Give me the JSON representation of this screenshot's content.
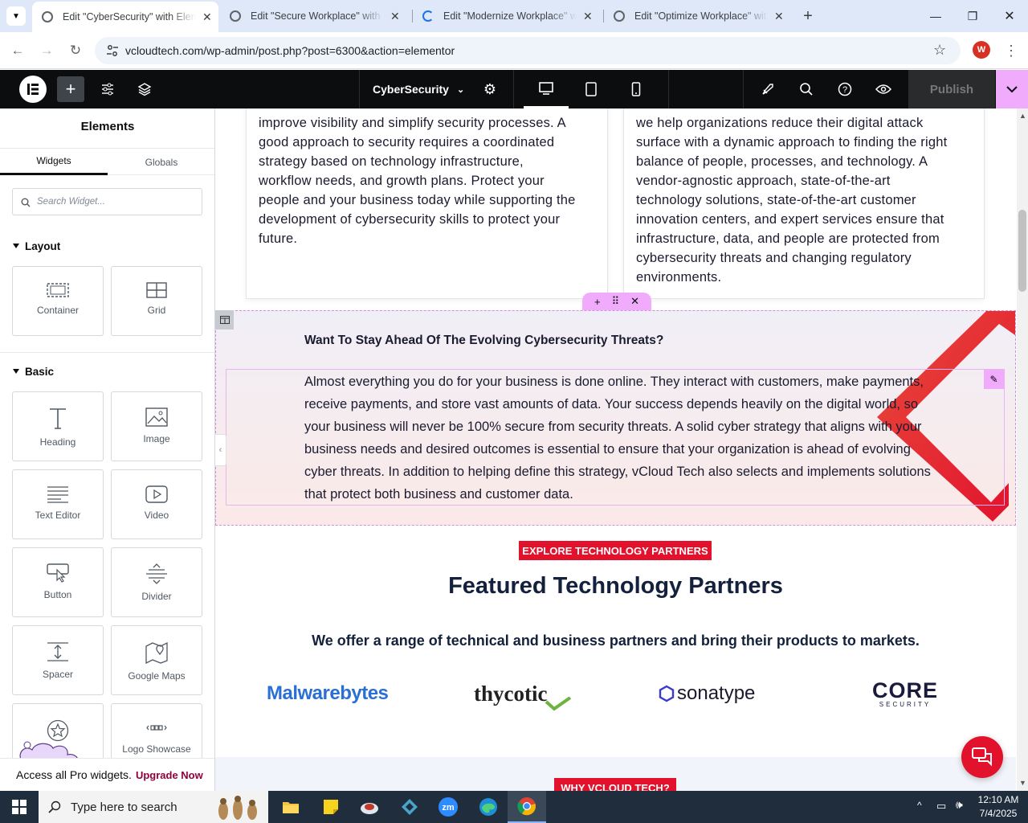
{
  "browser": {
    "tabs": [
      {
        "title": "Edit \"CyberSecurity\" with Eleme",
        "active": true
      },
      {
        "title": "Edit \"Secure Workplace\" with El",
        "active": false
      },
      {
        "title": "Edit \"Modernize Workplace\" wi",
        "active": false
      },
      {
        "title": "Edit \"Optimize Workplace\" with",
        "active": false
      }
    ],
    "url": "vcloudtech.com/wp-admin/post.php?post=6300&action=elementor",
    "profile_initial": "W"
  },
  "editor": {
    "document_name": "CyberSecurity",
    "publish_label": "Publish"
  },
  "panel": {
    "title": "Elements",
    "tabs": [
      "Widgets",
      "Globals"
    ],
    "search_placeholder": "Search Widget...",
    "sections": {
      "layout": "Layout",
      "basic": "Basic"
    },
    "layout_widgets": [
      "Container",
      "Grid"
    ],
    "basic_widgets": [
      "Heading",
      "Image",
      "Text Editor",
      "Video",
      "Button",
      "Divider",
      "Spacer",
      "Google Maps",
      "Logo Showcase"
    ],
    "pro_text": "Access all Pro widgets.",
    "pro_link": "Upgrade Now"
  },
  "page": {
    "left_box_lines": [
      "improve visibility and simplify security processes. A",
      "good approach to security requires a coordinated",
      "strategy based on technology infrastructure,",
      "workflow needs, and growth plans. Protect your",
      "people and your business today while supporting the",
      "development of cybersecurity skills to protect your",
      "future."
    ],
    "right_box_lines": [
      "we help organizations reduce their digital attack",
      "surface with a dynamic approach to finding the right",
      "balance of people, processes, and technology. A",
      "vendor-agnostic approach, state-of-the-art",
      "technology solutions, state-of-the-art customer",
      "innovation centers, and expert services ensure that",
      "infrastructure, data, and people are protected from",
      "cybersecurity threats and changing regulatory",
      "environments."
    ],
    "cta_heading": "Want To Stay Ahead Of The Evolving Cybersecurity Threats?",
    "cta_body": "Almost everything you do for your business is done online. They interact with customers, make payments, receive payments, and store vast amounts of data. Your success depends heavily on the digital world, so your business will never be 100% secure from security threats. A solid cyber strategy that aligns with your business needs and desired outcomes is essential to ensure that your organization is ahead of evolving cyber threats. In addition to helping define this strategy, vCloud Tech also selects and implements solutions that protect both business and customer data.",
    "explore_label": "EXPLORE TECHNOLOGY PARTNERS",
    "featured_title": "Featured Technology Partners",
    "featured_sub": "We offer a range of technical and business partners and bring their products to markets.",
    "partners": [
      "Malwarebytes",
      "thycotic",
      "sonatype",
      "CORE",
      "SECURITY"
    ],
    "why_label": "WHY VCLOUD TECH?"
  },
  "taskbar": {
    "search_placeholder": "Type here to search",
    "time": "12:10 AM",
    "date": "7/4/2025"
  },
  "colors": {
    "brand_red": "#e2122d",
    "elementor_pink": "#f0abfc",
    "navy": "#14213d"
  }
}
